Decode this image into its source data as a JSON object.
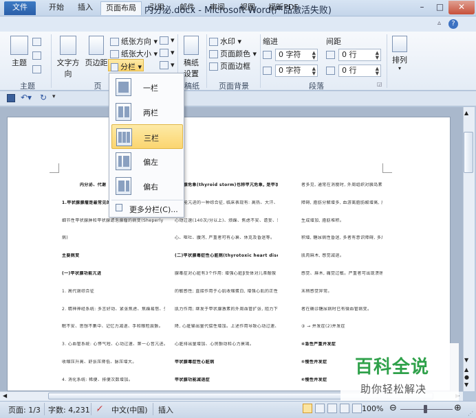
{
  "window": {
    "title": "内分泌.docx - Microsoft Word(产品激活失败)",
    "app_icon": "W",
    "min": "–",
    "max": "□",
    "close": "✕"
  },
  "tabs": [
    {
      "label": "文件",
      "active": false
    },
    {
      "label": "开始",
      "active": false
    },
    {
      "label": "插入",
      "active": false
    },
    {
      "label": "页面布局",
      "active": true
    },
    {
      "label": "引用",
      "active": false
    },
    {
      "label": "邮件",
      "active": false
    },
    {
      "label": "审阅",
      "active": false
    },
    {
      "label": "视图",
      "active": false
    },
    {
      "label": "福昕PDF",
      "active": false
    }
  ],
  "ribbon": {
    "theme_label": "主题",
    "theme_group": "主题",
    "text_direction": "文字方向",
    "margins": "页边距",
    "orientation": "纸张方向",
    "size": "纸张大小",
    "columns": "分栏",
    "page_setup_group": "页",
    "manuscript_line1": "稿纸",
    "manuscript_line2": "设置",
    "manuscript_group": "稿纸",
    "watermark": "水印",
    "page_color": "页面颜色",
    "page_border": "页面边框",
    "page_bg_group": "页面背景",
    "indent_label": "缩进",
    "indent_left": "0 字符",
    "indent_right": "0 字符",
    "spacing_label": "间距",
    "spacing_before": "0 行",
    "spacing_after": "0 行",
    "paragraph_group": "段落",
    "arrange": "排列"
  },
  "columns_menu": {
    "items": [
      {
        "label": "一栏",
        "selected": false
      },
      {
        "label": "两栏",
        "selected": false
      },
      {
        "label": "三栏",
        "selected": true
      },
      {
        "label": "偏左",
        "selected": false
      },
      {
        "label": "偏右",
        "selected": false
      }
    ],
    "more": "更多分栏(C)..."
  },
  "statusbar": {
    "page": "页面: 1/3",
    "words": "字数: 4,231",
    "language": "中文(中国)",
    "mode": "插入",
    "zoom": "100%"
  },
  "watermark": {
    "title": "百科全说",
    "subtitle": "助你轻松解决"
  },
  "document": {
    "col1": [
      "内分泌、代谢",
      "1.甲状腺腺瘤是最常见的甲状腺良性",
      "细节性甲状腺肿和甲状腺滤泡腺瘤的病变(Sheperly",
      "病)",
      "主要病变",
      "(一)甲状腺功能亢进",
      "1. 高代谢综合征",
      "2. 精神神经系统: 多言好动、紧张焦虑、焦躁易怒、失",
      "眠不安、思想不集中、记忆力减退、手和眼睑震颤。",
      "3. 心血管系统: 心悸气短、心动过速、第一心音亢进。",
      "收缩压升高、舒张压降低、脉压增大。",
      "4. 消化系统: 稀便、排便次数增加。"
    ],
    "col2": [
      "甲状腺危象(thyroid storm)也称甲亢危象, 是甲状",
      "腺功能亢进的一种综合征, 临床表现有: 高热、大汗、",
      "心动过速(140次/分以上)、烦躁、焦虑不安、谵妄、恶",
      "心、呕吐、腹泻, 严重者可有心衰、休克及昏迷等。",
      "(二)甲状腺毒症性心脏病(thyrotoxic heart disease)甲状",
      "腺毒症对心脏有3个作用: 增强心脏β受体对儿茶酚胺",
      "的敏感性; 直接作用于心肌收缩蛋白, 增强心肌的正性",
      "肌力作用; 继发于甲状腺激素的外周血管扩张, 阻力下",
      "降, 心脏输出量代偿性增加。上述作用导致心动过速、",
      "心脏排出量增加、心房颤动和心力衰竭。",
      "甲状腺毒症性心脏病",
      "甲状腺功能减退症"
    ],
    "col3": [
      "者多见, 通常在消瘦时, 外周组织对胰岛素利用",
      "障碍, 脂肪分解增多, 血游离脂肪酸增高, 肝脏",
      "生成增加, 脂肪堆积。",
      "积增, 糖尿病性昏迷, 多者有意识障碍, 多尿、",
      "肌肉麻木, 感觉减退。",
      "感觉、麻木, 痛觉过敏。严重者可出现溃疡。",
      "末梢感觉异常。",
      "者在确诊糖尿病时已有微血管病变。",
      "③ → 并发症(2)并发症",
      "④急性严重并发症",
      "⑤慢性并发症",
      "⑥慢性并发症"
    ]
  }
}
